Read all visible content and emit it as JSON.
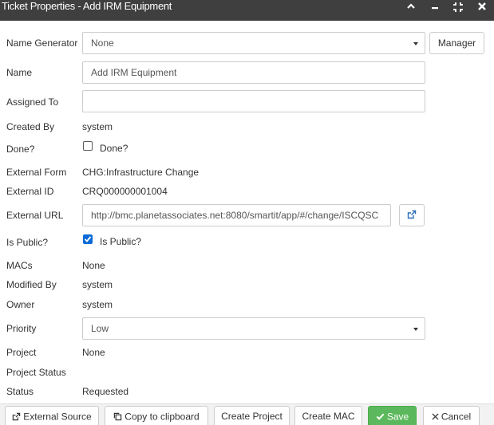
{
  "window": {
    "title": "Ticket Properties - Add IRM Equipment",
    "controls": {
      "collapse_icon": "chevron-up-icon",
      "minimize_icon": "minimize-icon",
      "expand_icon": "expand-icon",
      "close_icon": "close-icon"
    }
  },
  "form": {
    "name_generator": {
      "label": "Name Generator",
      "value": "None",
      "manager_button": "Manager"
    },
    "name": {
      "label": "Name",
      "value": "Add IRM Equipment"
    },
    "assigned_to": {
      "label": "Assigned To",
      "value": ""
    },
    "created_by": {
      "label": "Created By",
      "value": "system"
    },
    "done": {
      "label": "Done?",
      "checkbox_label": "Done?",
      "checked": false
    },
    "external_form": {
      "label": "External Form",
      "value": "CHG:Infrastructure Change"
    },
    "external_id": {
      "label": "External ID",
      "value": "CRQ000000001004"
    },
    "external_url": {
      "label": "External URL",
      "value": "http://bmc.planetassociates.net:8080/smartit/app/#/change/ISCQSC",
      "open_icon": "external-link-icon"
    },
    "is_public": {
      "label": "Is Public?",
      "checkbox_label": "Is Public?",
      "checked": true
    },
    "macs": {
      "label": "MACs",
      "value": "None"
    },
    "modified_by": {
      "label": "Modified By",
      "value": "system"
    },
    "owner": {
      "label": "Owner",
      "value": "system"
    },
    "priority": {
      "label": "Priority",
      "value": "Low"
    },
    "project": {
      "label": "Project",
      "value": "None"
    },
    "project_status": {
      "label": "Project Status",
      "value": ""
    },
    "status": {
      "label": "Status",
      "value": "Requested"
    }
  },
  "footer": {
    "external_source": "External Source",
    "copy_to_clipboard": "Copy to clipboard",
    "create_project": "Create Project",
    "create_mac": "Create MAC",
    "save": "Save",
    "cancel": "Cancel"
  },
  "colors": {
    "titlebar": "#3f3f3f",
    "save_green": "#5cb85c",
    "checkbox_blue": "#0b6bd6"
  }
}
